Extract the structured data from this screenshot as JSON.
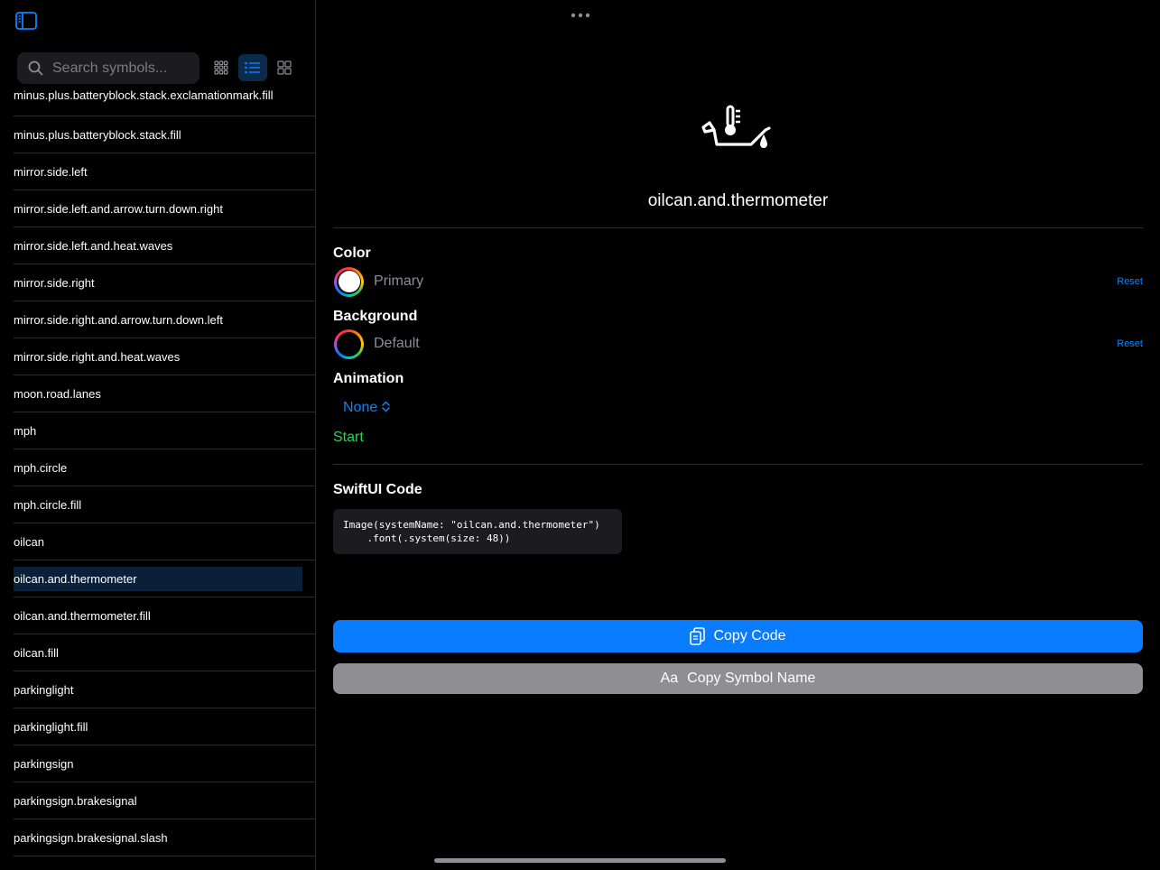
{
  "search": {
    "placeholder": "Search symbols..."
  },
  "symbols": [
    "minus.plus.batteryblock.stack.exclamationmark.fill",
    "minus.plus.batteryblock.stack.fill",
    "mirror.side.left",
    "mirror.side.left.and.arrow.turn.down.right",
    "mirror.side.left.and.heat.waves",
    "mirror.side.right",
    "mirror.side.right.and.arrow.turn.down.left",
    "mirror.side.right.and.heat.waves",
    "moon.road.lanes",
    "mph",
    "mph.circle",
    "mph.circle.fill",
    "oilcan",
    "oilcan.and.thermometer",
    "oilcan.and.thermometer.fill",
    "oilcan.fill",
    "parkinglight",
    "parkinglight.fill",
    "parkingsign",
    "parkingsign.brakesignal",
    "parkingsign.brakesignal.slash"
  ],
  "selected_symbol": "oilcan.and.thermometer",
  "detail": {
    "symbol_name": "oilcan.and.thermometer",
    "color_label": "Color",
    "color_value": "Primary",
    "background_label": "Background",
    "background_value": "Default",
    "reset_label": "Reset",
    "animation_label": "Animation",
    "animation_value": "None",
    "start_label": "Start",
    "code_label": "SwiftUI Code",
    "code_line1": "Image(systemName: \"oilcan.and.thermometer\")",
    "code_line2": "    .font(.system(size: 48))",
    "copy_code_label": "Copy Code",
    "copy_name_prefix": "Aa",
    "copy_name_label": "Copy Symbol Name"
  },
  "colors": {
    "accent": "#0a84ff",
    "start": "#30d158",
    "primary_button": "#0a7cff",
    "secondary_button": "#8e8e93"
  }
}
